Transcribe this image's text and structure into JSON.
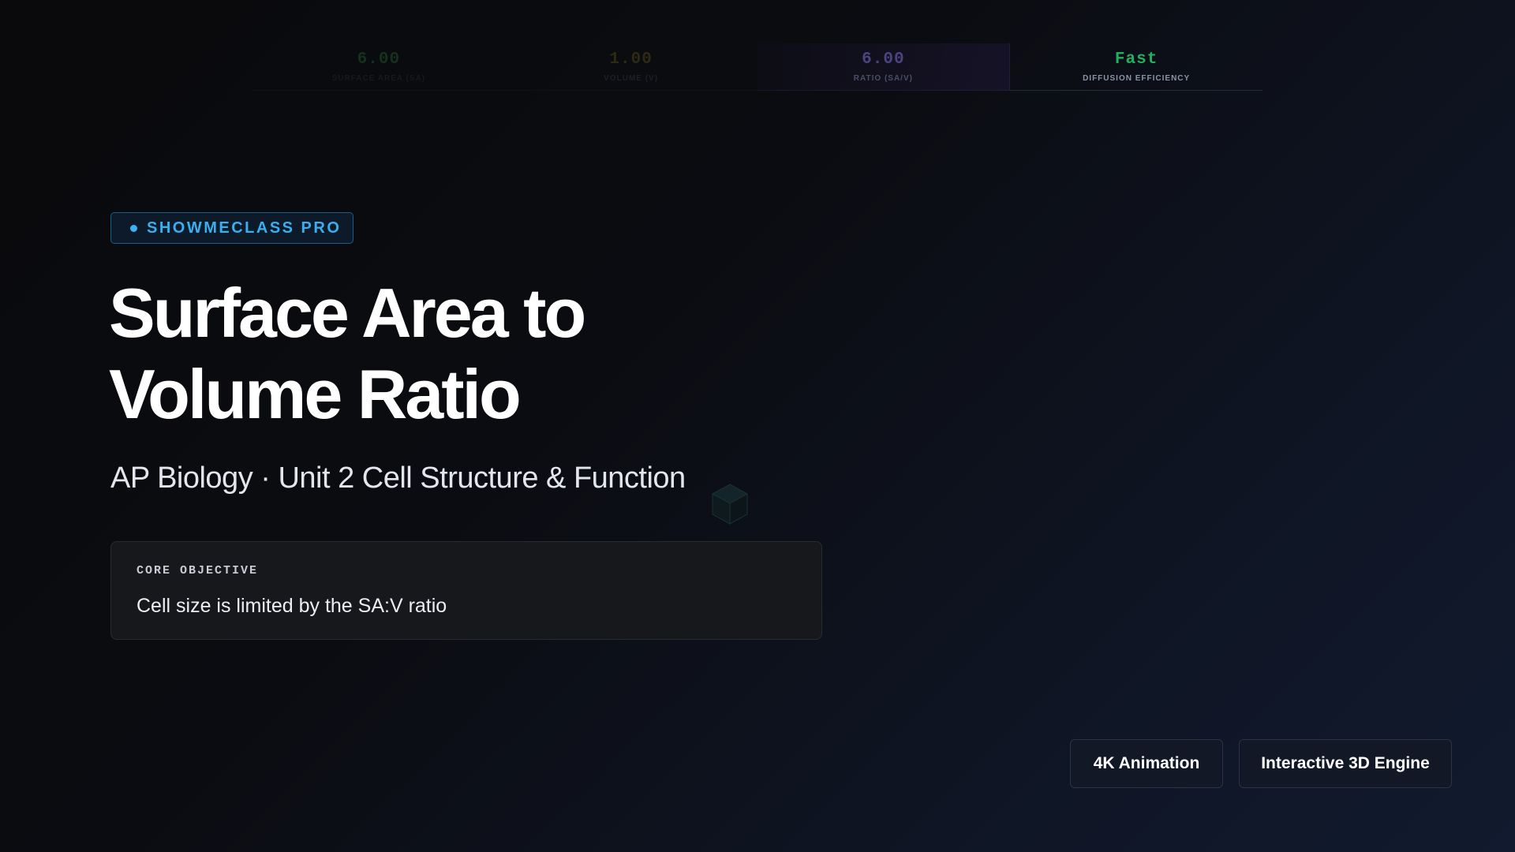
{
  "metrics": [
    {
      "value": "6.00",
      "label": "SURFACE AREA (SA)"
    },
    {
      "value": "1.00",
      "label": "VOLUME (V)"
    },
    {
      "value": "6.00",
      "label": "RATIO (SA/V)"
    },
    {
      "value": "Fast",
      "label": "DIFFUSION EFFICIENCY"
    }
  ],
  "badge": {
    "label": "SHOWMECLASS PRO"
  },
  "title": {
    "line1": "Surface Area to",
    "line2": "Volume Ratio"
  },
  "subtitle": "AP Biology · Unit 2 Cell Structure & Function",
  "objective": {
    "label": "CORE OBJECTIVE",
    "text": "Cell size is limited by the SA:V ratio"
  },
  "actions": {
    "animation_label": "4K Animation",
    "engine_label": "Interactive 3D Engine"
  },
  "colors": {
    "accent_blue": "#3aaff0",
    "fast_green": "#23b05e",
    "ratio_purple": "#4b4480"
  },
  "icons": {
    "cube": "cube-icon",
    "badge_dot": "status-dot-icon"
  }
}
